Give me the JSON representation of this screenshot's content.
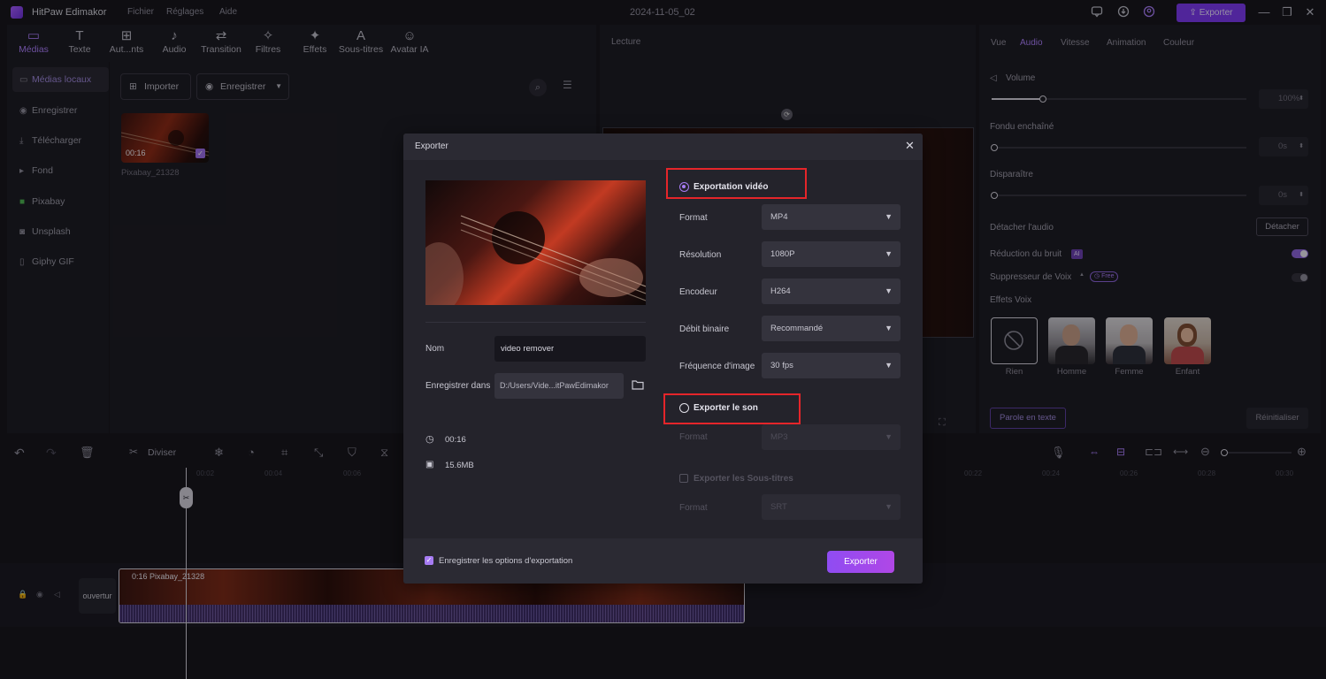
{
  "titlebar": {
    "app_name": "HitPaw Edimakor",
    "menus": [
      "Fichier",
      "Réglages",
      "Aide"
    ],
    "project_name": "2024-11-05_02",
    "export_label": "Exporter",
    "icons": [
      "comment-icon",
      "download-icon",
      "user-icon",
      "minimize-icon",
      "restore-icon",
      "close-icon"
    ]
  },
  "toolbar": {
    "tools": [
      "Médias",
      "Texte",
      "Aut...nts",
      "Audio",
      "Transition",
      "Filtres",
      "Effets",
      "Sous-titres",
      "Avatar IA"
    ]
  },
  "sidebar": {
    "items": [
      "Médias locaux",
      "Enregistrer",
      "Télécharger",
      "Fond",
      "Pixabay",
      "Unsplash",
      "Giphy GIF"
    ]
  },
  "media": {
    "import_label": "Importer",
    "record_label": "Enregistrer",
    "clip_duration": "00:16",
    "clip_name": "Pixabay_21328"
  },
  "preview": {
    "title": "Lecture"
  },
  "right_panel": {
    "tabs": [
      "Vue",
      "Audio",
      "Vitesse",
      "Animation",
      "Couleur"
    ],
    "active_tab": "Audio",
    "volume_label": "Volume",
    "volume_value": "100%",
    "volume_level": 0.2,
    "fade_in_label": "Fondu enchaîné",
    "fade_in_value": "0s",
    "fade_out_label": "Disparaître",
    "fade_out_value": "0s",
    "detach_label": "Détacher l'audio",
    "detach_button": "Détacher",
    "noise_label": "Réduction du bruit",
    "noise_badge": "AI",
    "voice_remover_label": "Suppresseur de Voix",
    "free_badge": "Free",
    "voice_effects_label": "Effets Voix",
    "voices": [
      "Rien",
      "Homme",
      "Femme",
      "Enfant"
    ],
    "speech_to_text": "Parole en texte",
    "reset": "Réinitialiser",
    "accent": "#a77cf4"
  },
  "timeline": {
    "split_label": "Diviser",
    "ticks": [
      "00:02",
      "00:04",
      "00:06",
      "00:22",
      "00:24",
      "00:26",
      "00:28",
      "00:30"
    ],
    "clip_label": "0:16  Pixabay_21328",
    "cover_label": "ouvertur"
  },
  "export_dialog": {
    "title": "Exporter",
    "name_label": "Nom",
    "name_value": "video remover",
    "save_in_label": "Enregistrer dans",
    "save_in_value": "D:/Users/Vide...itPawEdimakor",
    "duration": "00:16",
    "size": "15.6MB",
    "video_export_label": "Exportation vidéo",
    "format_label": "Format",
    "format_value": "MP4",
    "resolution_label": "Résolution",
    "resolution_value": "1080P",
    "encoder_label": "Encodeur",
    "encoder_value": "H264",
    "bitrate_label": "Débit binaire",
    "bitrate_value": "Recommandé",
    "framerate_label": "Fréquence d'image",
    "framerate_value": "30  fps",
    "audio_export_label": "Exporter le son",
    "audio_format_label": "Format",
    "audio_format_value": "MP3",
    "subs_label": "Exporter les Sous-titres",
    "subs_format_label": "Format",
    "subs_format_value": "SRT",
    "save_options_label": "Enregistrer les options d'exportation",
    "export_button": "Exporter",
    "highlight_color": "#e5252a"
  }
}
